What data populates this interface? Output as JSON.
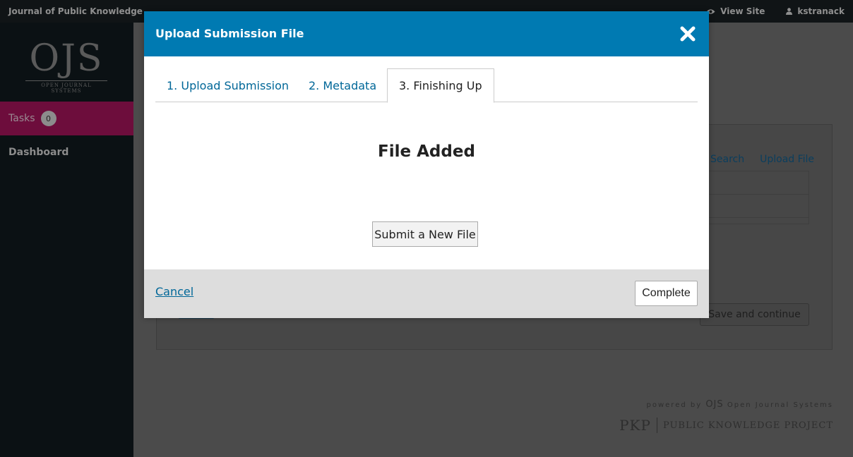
{
  "topbar": {
    "site_name": "Journal of Public Knowledge",
    "view_site": "View Site",
    "username": "kstranack"
  },
  "sidebar": {
    "logo_text": "OJS",
    "logo_subtext": "OPEN JOURNAL SYSTEMS",
    "tasks_label": "Tasks",
    "tasks_count": "0",
    "dashboard_label": "Dashboard"
  },
  "background": {
    "search_link": "Search",
    "upload_file_link": "Upload File",
    "save_continue": "Save and continue"
  },
  "footer": {
    "powered_by": "powered by",
    "ojs": "OJS",
    "ojs_full": "Open Journal Systems",
    "pkp": "PKP",
    "pkp_full": "PUBLIC KNOWLEDGE PROJECT"
  },
  "modal": {
    "title": "Upload Submission File",
    "tabs": [
      {
        "label": "1. Upload Submission"
      },
      {
        "label": "2. Metadata"
      },
      {
        "label": "3. Finishing Up"
      }
    ],
    "active_tab": 2,
    "heading": "File Added",
    "new_file_button": "Submit a New File",
    "cancel_label": "Cancel",
    "complete_label": "Complete"
  },
  "colors": {
    "header_blue": "#007ab2",
    "link_blue": "#006798",
    "tasks_active": "#6d0d3c"
  }
}
